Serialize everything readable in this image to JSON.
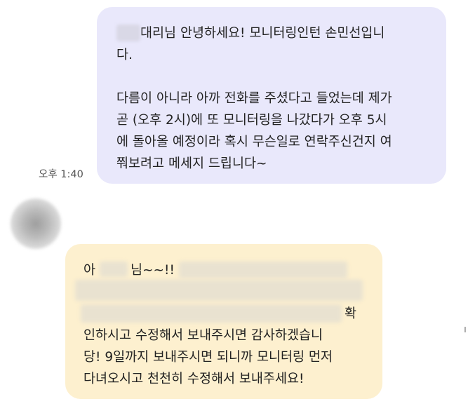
{
  "outgoing": {
    "timestamp": "오후 1:40",
    "line1_after_name": "대리님 안녕하세요! 모니터링인턴 손민선입니",
    "line2": "다.",
    "line3": "다름이 아니라 아까 전화를 주셨다고 들었는데 제가",
    "line4": "곧 (오후 2시)에 또 모니터링을 나갔다가 오후 5시",
    "line5": "에 돌아올 예정이라 혹시 무슨일로 연락주신건지 여",
    "line6": "쭤보려고 메세지 드립니다~"
  },
  "incoming": {
    "prefix": "아",
    "suffix": "님~~!!",
    "line_end": "확",
    "line4": "인하시고 수정해서 보내주시면 감사하겠습니",
    "line5": "당! 9일까지 보내주시면 되니까 모니터링 먼저",
    "line6": "다녀오시고 천천히 수정해서 보내주세요!"
  },
  "edge_glyph": "ı"
}
